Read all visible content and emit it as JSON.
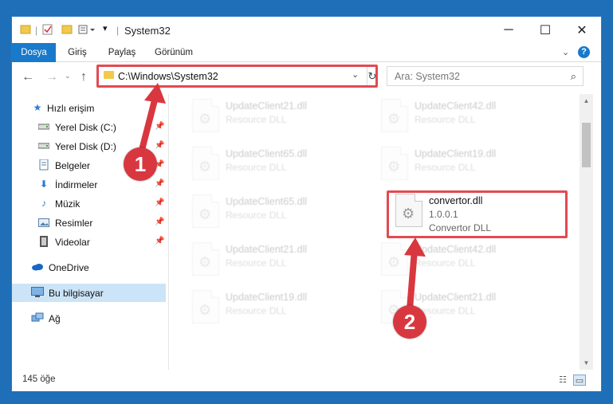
{
  "window": {
    "title": "System32",
    "controls": {
      "minimize": "─",
      "maximize": "☐",
      "close": "✕"
    }
  },
  "ribbon": {
    "tabs": [
      {
        "label": "Dosya",
        "active": true
      },
      {
        "label": "Giriş"
      },
      {
        "label": "Paylaş"
      },
      {
        "label": "Görünüm"
      }
    ]
  },
  "address": {
    "path": "C:\\Windows\\System32",
    "search_placeholder": "Ara: System32"
  },
  "sidebar": {
    "items": [
      {
        "label": "Hızlı erişim",
        "icon": "star-icon",
        "pinned": false
      },
      {
        "label": "Yerel Disk (C:)",
        "icon": "drive-icon",
        "pinned": true
      },
      {
        "label": "Yerel Disk (D:)",
        "icon": "drive-icon",
        "pinned": true
      },
      {
        "label": "Belgeler",
        "icon": "documents-icon",
        "pinned": true
      },
      {
        "label": "İndirmeler",
        "icon": "download-icon",
        "pinned": true
      },
      {
        "label": "Müzik",
        "icon": "music-icon",
        "pinned": true
      },
      {
        "label": "Resimler",
        "icon": "pictures-icon",
        "pinned": true
      },
      {
        "label": "Videolar",
        "icon": "videos-icon",
        "pinned": true
      },
      {
        "label": "OneDrive",
        "icon": "cloud-icon",
        "pinned": false
      },
      {
        "label": "Bu bilgisayar",
        "icon": "computer-icon",
        "pinned": false,
        "selected": true
      },
      {
        "label": "Ağ",
        "icon": "network-icon",
        "pinned": false
      }
    ]
  },
  "files": [
    {
      "name": "UpdateClient21.dll",
      "sub": "Resource DLL",
      "faded": true
    },
    {
      "name": "UpdateClient42.dll",
      "sub": "Resource DLL",
      "faded": true
    },
    {
      "name": "UpdateClient65.dll",
      "sub": "Resource DLL",
      "faded": true
    },
    {
      "name": "UpdateClient19.dll",
      "sub": "Resource DLL",
      "faded": true
    },
    {
      "name": "UpdateClient65.dll",
      "sub": "Resource DLL",
      "faded": true
    },
    {
      "name": "convertor.dll",
      "version": "1.0.0.1",
      "sub": "Convertor DLL",
      "faded": false
    },
    {
      "name": "UpdateClient21.dll",
      "sub": "Resource DLL",
      "faded": true
    },
    {
      "name": "UpdateClient42.dll",
      "sub": "Resource DLL",
      "faded": true
    },
    {
      "name": "UpdateClient19.dll",
      "sub": "Resource DLL",
      "faded": true
    },
    {
      "name": "UpdateClient21.dll",
      "sub": "Resource DLL",
      "faded": true
    }
  ],
  "status": {
    "item_count": "145 öğe"
  },
  "annotations": {
    "step1": "1",
    "step2": "2",
    "color": "#d9373f"
  }
}
